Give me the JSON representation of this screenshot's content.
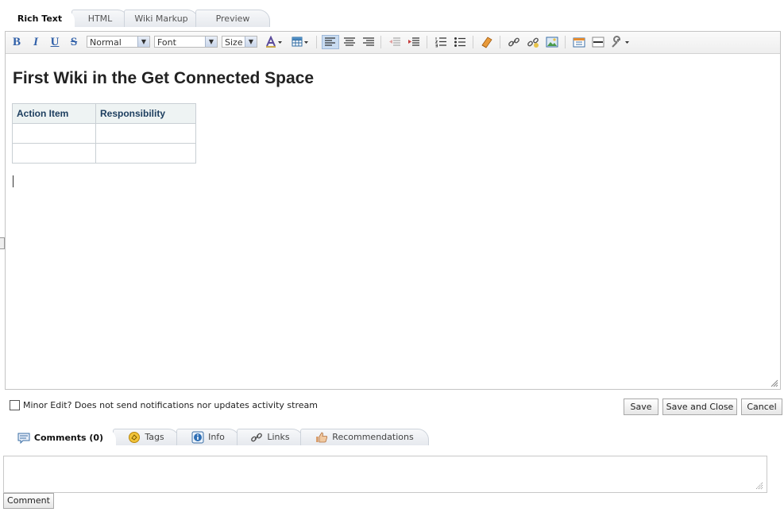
{
  "editor_tabs": [
    "Rich Text",
    "HTML",
    "Wiki Markup",
    "Preview"
  ],
  "toolbar": {
    "bold": "B",
    "italic": "I",
    "underline": "U",
    "strike": "S",
    "format_select": "Normal",
    "font_select": "Font",
    "size_select": "Size"
  },
  "document": {
    "title": "First Wiki in the Get Connected Space",
    "table_headers": [
      "Action Item",
      "Responsibility"
    ]
  },
  "minor_edit_label": "Minor Edit? Does not send notifications nor updates activity stream",
  "buttons": {
    "save": "Save",
    "save_close": "Save and Close",
    "cancel": "Cancel"
  },
  "bottom_tabs": [
    "Comments (0)",
    "Tags",
    "Info",
    "Links",
    "Recommendations"
  ],
  "comment_button": "Comment",
  "colors": {
    "tab_border": "#cdd3db",
    "header_cell": "#eef3f3",
    "header_text": "#1c3d5e",
    "active_align": "#c9dcf2"
  }
}
